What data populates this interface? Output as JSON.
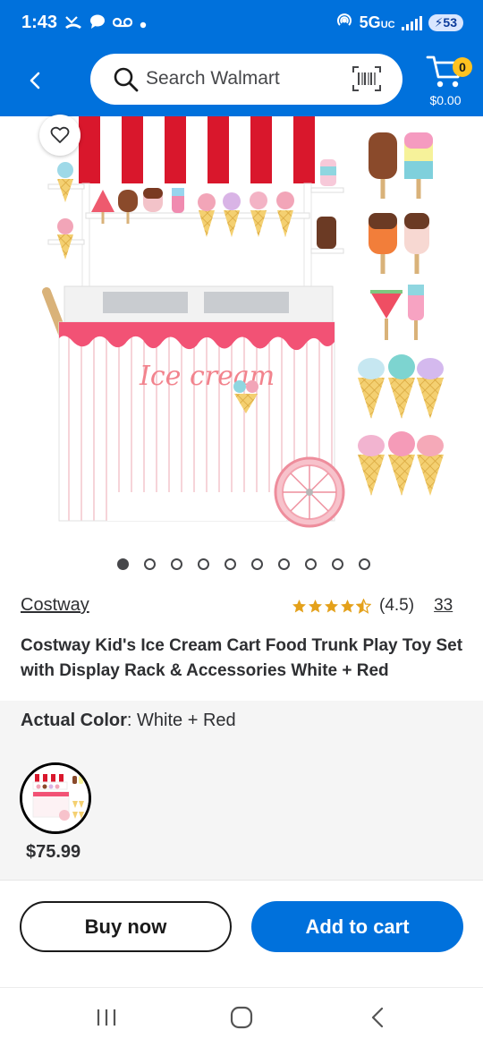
{
  "status_bar": {
    "time": "1:43",
    "network": "5G",
    "network_sub": "UC",
    "battery": "53"
  },
  "header": {
    "search_placeholder": "Search Walmart",
    "cart_count": "0",
    "cart_total": "$0.00"
  },
  "gallery": {
    "image_count": 10,
    "active_index": 0,
    "image_text": "Ice cream"
  },
  "product": {
    "brand": "Costway",
    "rating": 4.5,
    "rating_text": "(4.5)",
    "review_count": "33",
    "title": "Costway Kid's Ice Cream Cart Food Trunk Play Toy Set with Display Rack & Accessories White + Red"
  },
  "variant": {
    "label": "Actual Color",
    "value": "White + Red",
    "price": "$75.99"
  },
  "actions": {
    "buy_now": "Buy now",
    "add_to_cart": "Add to cart"
  },
  "colors": {
    "brand_blue": "#0071dc",
    "spark_yellow": "#ffc220",
    "star_color": "#e4a11b"
  }
}
